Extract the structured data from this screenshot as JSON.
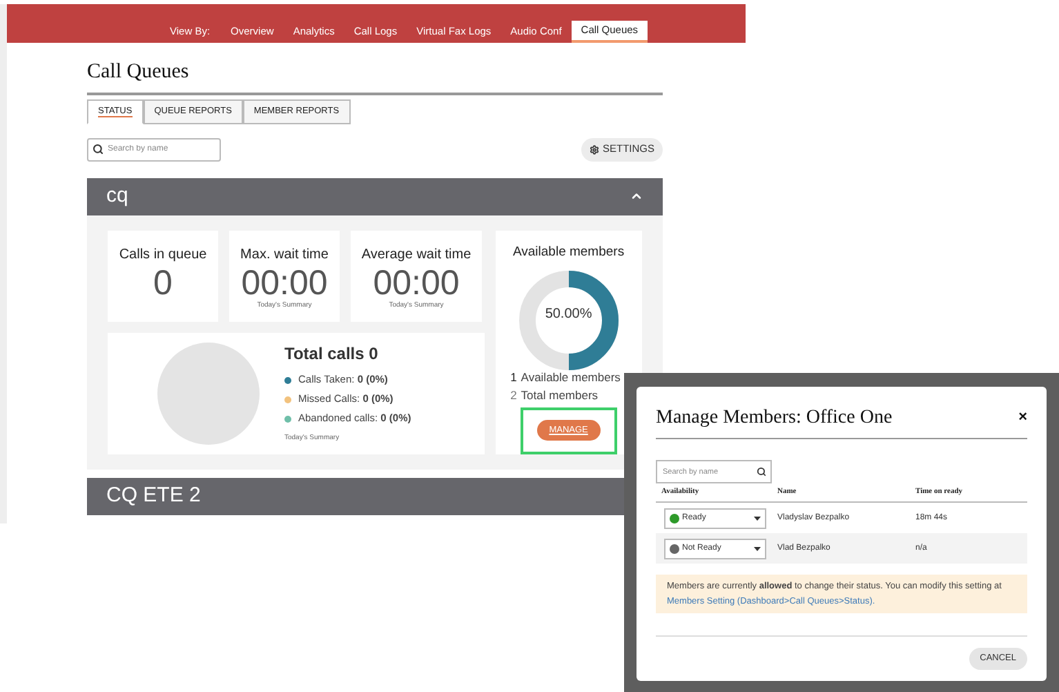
{
  "nav": {
    "label": "View By:",
    "items": [
      {
        "label": "Overview",
        "selected": false
      },
      {
        "label": "Analytics",
        "selected": false
      },
      {
        "label": "Call Logs",
        "selected": false
      },
      {
        "label": "Virtual Fax Logs",
        "selected": false
      },
      {
        "label": "Audio Conf",
        "selected": false
      },
      {
        "label": "Call Queues",
        "selected": true
      }
    ]
  },
  "title": "Call Queues",
  "tabs": [
    {
      "label": "STATUS",
      "selected": true
    },
    {
      "label": "QUEUE REPORTS",
      "selected": false
    },
    {
      "label": "MEMBER REPORTS",
      "selected": false
    }
  ],
  "search": {
    "placeholder": "Search by name"
  },
  "settings_button": "SETTINGS",
  "queues": [
    {
      "name": "cq",
      "expanded": true,
      "stats": [
        {
          "label": "Calls in queue",
          "value": "0"
        },
        {
          "label": "Max. wait time",
          "value": "00:00",
          "note": "Today's Summary"
        },
        {
          "label": "Average wait time",
          "value": "00:00",
          "note": "Today's Summary"
        }
      ],
      "total": {
        "title": "Total calls 0",
        "legend": [
          {
            "label": "Calls Taken:",
            "value": "0 (0%)",
            "color": "#2f7d96"
          },
          {
            "label": "Missed Calls:",
            "value": "0 (0%)",
            "color": "#f2c27e"
          },
          {
            "label": "Abandoned calls:",
            "value": "0 (0%)",
            "color": "#6fbfa9"
          }
        ],
        "note": "Today's Summary"
      },
      "members": {
        "title": "Available members",
        "percent": "50.00%",
        "level": 0.5,
        "available_count": "1",
        "available_label": "Available members",
        "total_count": "2",
        "total_label": "Total members",
        "manage_button": "MANAGE",
        "highlighted": true
      }
    },
    {
      "name": "CQ ETE 2",
      "expanded": false
    }
  ],
  "dialog": {
    "title": "Manage Members: Office One",
    "close": "×",
    "search": {
      "placeholder": "Search by name"
    },
    "columns": [
      "Availability",
      "Name",
      "Time on ready"
    ],
    "rows": [
      {
        "status": "Ready",
        "color": "#2e9a2a",
        "name": "Vladyslav Bezpalko",
        "time": "18m 44s"
      },
      {
        "status": "Not Ready",
        "color": "#666666",
        "name": "Vlad Bezpalko",
        "time": "n/a"
      }
    ],
    "notice": "Members are currently **allowed** to change their status. You can modify this setting at",
    "notice_link": "Members Setting (Dashboard>Call Queues>Status).",
    "cancel_button": "CANCEL"
  }
}
